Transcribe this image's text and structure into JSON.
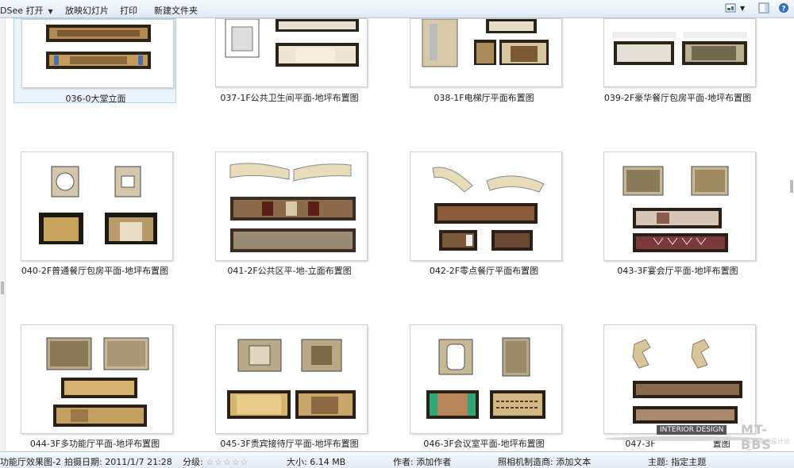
{
  "toolbar": {
    "open_label": "DSee 打开",
    "slideshow_label": "放映幻灯片",
    "print_label": "打印",
    "new_folder_label": "新建文件夹"
  },
  "tiles": [
    {
      "caption": "036-0大堂立面"
    },
    {
      "caption": "037-1F公共卫生间平面-地坪布置图"
    },
    {
      "caption": "038-1F电梯厅平面布置图"
    },
    {
      "caption": "039-2F豪华餐厅包房平面-地坪布置图"
    },
    {
      "caption": "040-2F普通餐厅包房平面-地坪布置图"
    },
    {
      "caption": "041-2F公共区平-地-立面布置图"
    },
    {
      "caption": "042-2F零点餐厅平面布置图"
    },
    {
      "caption": "043-3F宴会厅平面-地坪布置图"
    },
    {
      "caption": "044-3F多功能厅平面-地坪布置图"
    },
    {
      "caption": "045-3F贵宾接待厅平面-地坪布置图"
    },
    {
      "caption": "046-3F会议室平面-地坪布置图"
    },
    {
      "caption": "047-3F"
    },
    {
      "caption_tail": "置图"
    }
  ],
  "watermark": {
    "line1": "INTERIOR DESIGN",
    "line2": "MT-BBS",
    "line3": "马蹄室内设计论坛"
  },
  "statusbar": {
    "filename": "功能厅效果图-2",
    "date": "拍摄日期: 2011/1/7 21:28",
    "rating_label": "分级:",
    "stars": "☆☆☆☆☆",
    "size": "大小: 6.14 MB",
    "author": "作者: 添加作者",
    "camera": "照相机制造商: 添加文本",
    "subject": "主题: 指定主题"
  },
  "colors": {
    "accent": "#b6cfea",
    "wood": "#8a6a3c",
    "dark": "#2b2218"
  }
}
